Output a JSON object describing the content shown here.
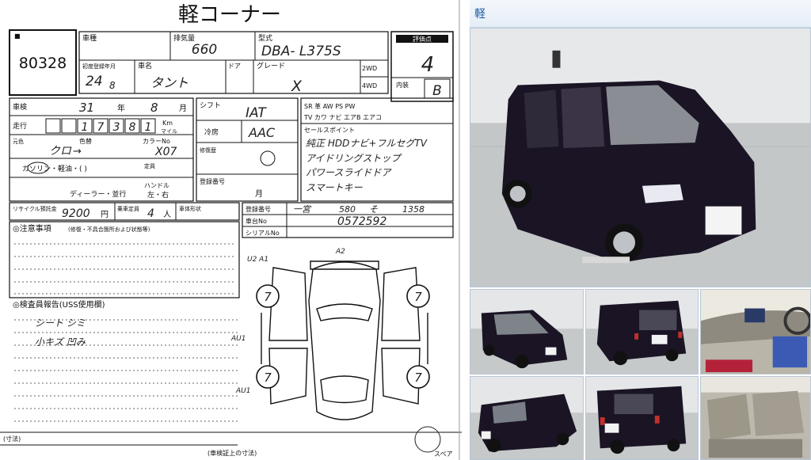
{
  "sheet": {
    "title": "軽コーナー",
    "lot_no": "80328",
    "labels": {
      "maker_model": "車種",
      "displacement_label": "排気量",
      "model_code_label": "型式",
      "score_label": "評価点",
      "reg_year_label": "初度登録年月",
      "car_name_label": "車名",
      "doors_label": "ドア",
      "grade_label": "グレード",
      "drive_2wd": "2WD",
      "drive_4wd": "4WD",
      "interior_label": "内装",
      "inspection_label": "車検",
      "year_unit": "年",
      "month_unit": "月",
      "shift_label": "シフト",
      "mileage_label": "走行",
      "km_label": "Km",
      "mile_label": "マイル",
      "cooler_label": "冷房",
      "color_orig_label": "元色",
      "color_label": "色替",
      "color_no_label": "カラーNo",
      "history_label": "修復歴",
      "fuel_label": "ガソリン・軽油・(  )",
      "seats_label": "定員",
      "nav_row": "SR  革  AW  PS  PW",
      "nav_row2": "TV  カワ  ナビ  エアB  エアコ",
      "sale_points_label": "セールスポイント",
      "import_label": "ディーラー・並行",
      "handle_label": "ハンドル",
      "handle_value": "左・右",
      "recycle_label": "リサイクル預託金",
      "capacity_label": "乗車定員",
      "vehicle_type_label": "車体形状",
      "frame_label": "車台No",
      "serial_label": "シリアルNo",
      "reg_no_label": "登録番号",
      "notes_label": "◎注意事項",
      "notes_sub": "(修復・不具合箇所および状態等)",
      "inspector_label": "◎検査員報告(USS使用欄)",
      "dims_label": "(寸法)",
      "spare_label": "スペア",
      "arrow_note": "(車検証上の寸法)"
    },
    "values": {
      "displacement": "660",
      "model_code": "DBA- L375S",
      "score": "4",
      "interior_score": "B",
      "reg_year": "24",
      "reg_month": "8",
      "car_name": "タント",
      "grade": "X",
      "inspection_year": "31",
      "inspection_month": "8",
      "shift": "IAT",
      "mileage_digits": [
        "1",
        "7",
        "3",
        "8",
        "1"
      ],
      "cooler": "AAC",
      "color_orig": "クロ",
      "color_arrow": "→",
      "color_no": "X07",
      "seats": "4",
      "recycle_fee": "9200",
      "recycle_unit": "円",
      "capacity_unit": "人",
      "frame_no": "0572592",
      "reg_no_a": "一宮",
      "reg_no_b": "580",
      "reg_no_c": "そ",
      "reg_no_d": "1358",
      "sale_points": [
        "純正 HDDナビ+フルセグTV",
        "アイドリングストップ",
        "パワースライドドア",
        "スマートキー"
      ],
      "inspector_notes": [
        "シート シミ",
        "小キズ 凹み"
      ],
      "diagram_tags": [
        "U2 A1",
        "A2",
        "AU1",
        "AU1"
      ],
      "tire_marks": [
        "7",
        "7",
        "7",
        "7"
      ]
    }
  },
  "gallery": {
    "title": "軽",
    "colors": {
      "car": "#1a1424",
      "floor": "#c9cbcc",
      "wall": "#dfe2e4",
      "accent": "#1f5fa6"
    }
  }
}
